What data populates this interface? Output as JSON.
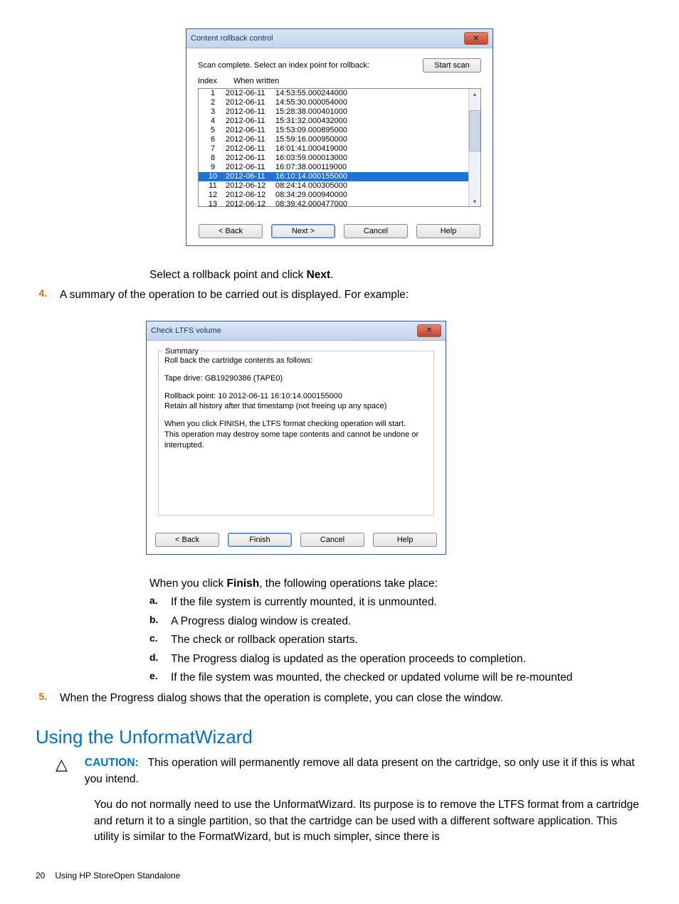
{
  "dialog1": {
    "title": "Content rollback control",
    "close": "✕",
    "scan_msg": "Scan complete.  Select an index point for rollback:",
    "start_scan": "Start scan",
    "col_index": "Index",
    "col_when": "When written",
    "rows": [
      {
        "idx": "1",
        "date": "2012-06-11",
        "time": "14:53:55.000244000"
      },
      {
        "idx": "2",
        "date": "2012-06-11",
        "time": "14:55:30.000054000"
      },
      {
        "idx": "3",
        "date": "2012-06-11",
        "time": "15:28:38.000401000"
      },
      {
        "idx": "4",
        "date": "2012-06-11",
        "time": "15:31:32.000432000"
      },
      {
        "idx": "5",
        "date": "2012-06-11",
        "time": "15:53:09.000895000"
      },
      {
        "idx": "6",
        "date": "2012-06-11",
        "time": "15:59:16.000950000"
      },
      {
        "idx": "7",
        "date": "2012-06-11",
        "time": "16:01:41.000419000"
      },
      {
        "idx": "8",
        "date": "2012-06-11",
        "time": "16:03:59.000013000"
      },
      {
        "idx": "9",
        "date": "2012-06-11",
        "time": "16:07:38.000119000"
      },
      {
        "idx": "10",
        "date": "2012-06-11",
        "time": "16:10:14.000155000"
      },
      {
        "idx": "11",
        "date": "2012-06-12",
        "time": "08:24:14.000305000"
      },
      {
        "idx": "12",
        "date": "2012-06-12",
        "time": "08:34:29.000940000"
      },
      {
        "idx": "13",
        "date": "2012-06-12",
        "time": "08:39:42.000477000"
      }
    ],
    "back": "< Back",
    "next": "Next >",
    "cancel": "Cancel",
    "help": "Help"
  },
  "dialog2": {
    "title": "Check LTFS volume",
    "close": "✕",
    "legend": "Summary",
    "line1": "Roll back the cartridge contents as follows:",
    "line2": "Tape drive: GB19290386 (TAPE0)",
    "line3": "Rollback point:    10       2012-06-11   16:10:14.000155000",
    "line4": "Retain all history after that timestamp (not freeing up any space)",
    "line5": "When you click FINISH, the LTFS format checking operation will start.",
    "line6": "This operation may destroy some tape contents and cannot be undone or interrupted.",
    "back": "< Back",
    "finish": "Finish",
    "cancel": "Cancel",
    "help": "Help"
  },
  "text": {
    "select_rollback_a": "Select a rollback point and click ",
    "select_rollback_b": "Next",
    "select_rollback_c": ".",
    "step4_num": "4.",
    "step4": "A summary of the operation to be carried out is displayed. For example:",
    "click_finish_a": "When you click ",
    "click_finish_b": "Finish",
    "click_finish_c": ", the following operations take place:",
    "a": "a.",
    "a_text": "If the file system is currently mounted, it is unmounted.",
    "b": "b.",
    "b_text": "A Progress dialog window is created.",
    "c": "c.",
    "c_text": "The check or rollback operation starts.",
    "d": "d.",
    "d_text": "The Progress dialog is updated as the operation proceeds to completion.",
    "e": "e.",
    "e_text": "If the file system was mounted, the checked or updated volume will be re-mounted",
    "step5_num": "5.",
    "step5": "When the Progress dialog shows that the operation is complete, you can close the window.",
    "section_h": "Using the UnformatWizard",
    "caution_label": "CAUTION:",
    "caution_text": "This operation will permanently remove all data present on the cartridge, so only use it if this is what you intend.",
    "para": "You do not normally need to use the UnformatWizard. Its purpose is to remove the LTFS format from a cartridge and return it to a single partition, so that the cartridge can be used with a different software application. This utility is similar to the FormatWizard, but is much simpler, since there is",
    "page_num": "20",
    "page_title": "Using HP StoreOpen Standalone"
  }
}
